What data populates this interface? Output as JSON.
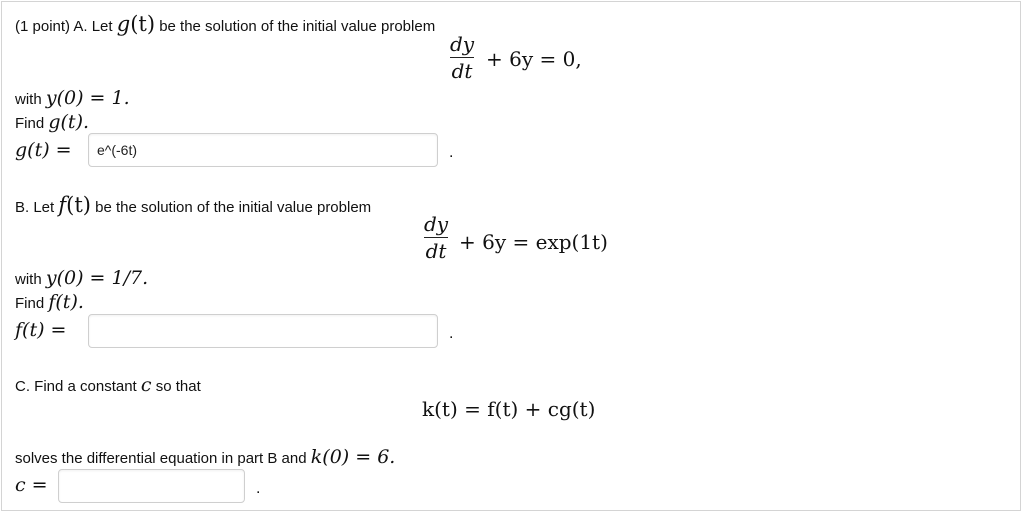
{
  "part_a": {
    "intro_prefix": "(1 point) A. Let",
    "intro_fn": "g",
    "intro_arg": "(t)",
    "intro_suffix": "be the solution of the initial value problem",
    "deriv_num": "dy",
    "deriv_den": "dt",
    "equation_rhs": "+ 6y = 0,",
    "with_label": "with",
    "initial_condition": "y(0) = 1.",
    "find_label": "Find",
    "find_expr": "g(t).",
    "answer_label": "g(t) =",
    "answer_value": "e^(-6t)",
    "trailing_dot": "."
  },
  "part_b": {
    "intro_prefix": "B. Let",
    "intro_fn": "f",
    "intro_arg": "(t)",
    "intro_suffix": "be the solution of the initial value problem",
    "deriv_num": "dy",
    "deriv_den": "dt",
    "equation_rhs": "+ 6y = exp(1t)",
    "with_label": "with",
    "initial_condition": "y(0) = 1/7.",
    "find_label": "Find",
    "find_expr": "f(t).",
    "answer_label": "f(t) =",
    "answer_value": "",
    "trailing_dot": "."
  },
  "part_c": {
    "intro_prefix": "C. Find a constant",
    "intro_var": "c",
    "intro_suffix": "so that",
    "equation": "k(t) = f(t) + cg(t)",
    "solves_text": "solves the differential equation in part B and",
    "solves_expr": "k(0) = 6.",
    "answer_label": "c =",
    "answer_value": "",
    "trailing_dot": "."
  }
}
